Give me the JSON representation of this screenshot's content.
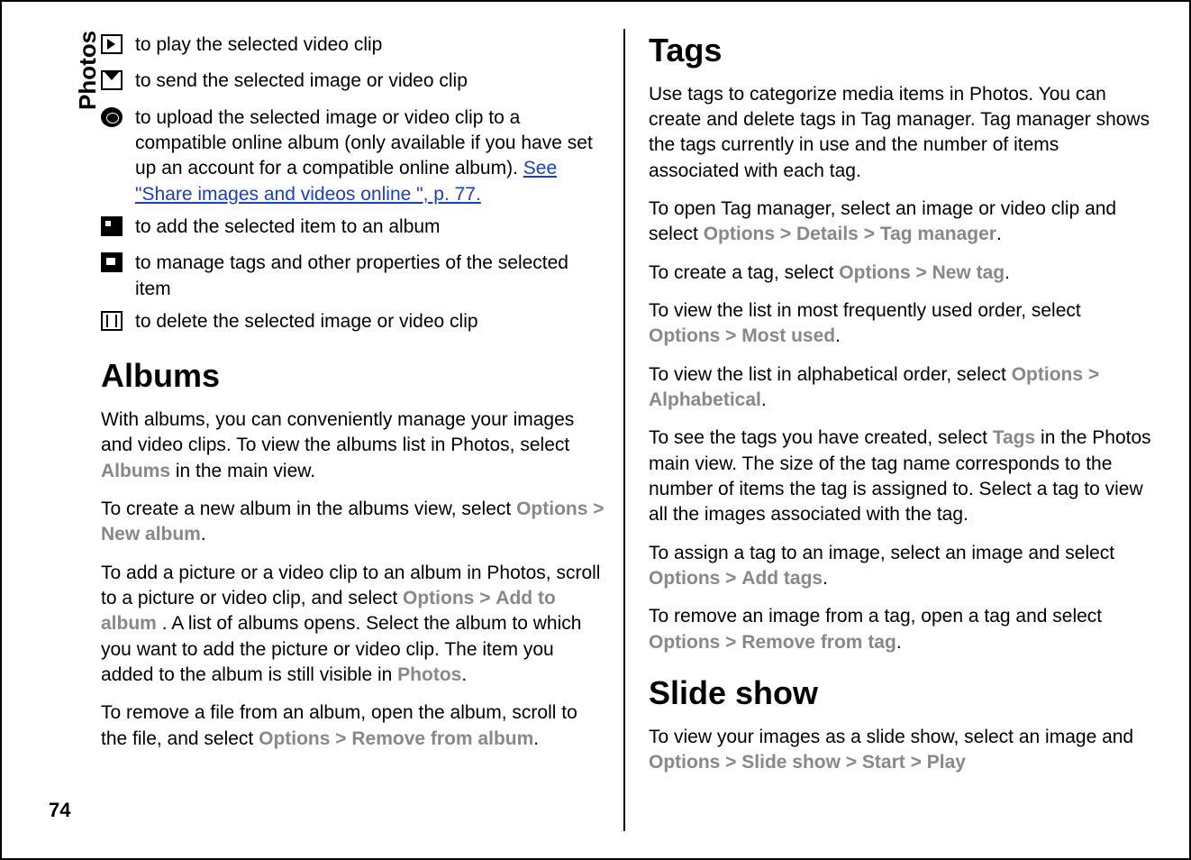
{
  "sidebar": {
    "label": "Photos",
    "page_number": "74"
  },
  "left": {
    "actions": {
      "play": "to play the selected video clip",
      "send": "to send the selected image or video clip",
      "upload_pre": " to upload the selected image or video clip to a compatible online album (only available if you have set up an account for a compatible online album). ",
      "upload_link": "See \"Share images and videos online \", p. 77.",
      "album": "to add the selected item to an album",
      "tags": "to manage tags and other properties of the selected item",
      "delete": "to delete the selected image or video clip"
    },
    "albums": {
      "heading": "Albums",
      "p1a": "With albums, you can conveniently manage your images and video clips. To view the albums list in Photos, select ",
      "p1_menu": "Albums",
      "p1b": " in the main view.",
      "p2a": "To create a new album in the albums view, select ",
      "p2_m1": "Options",
      "p2_m2": "New album",
      "p3a": "To add a picture or a video clip to an album in Photos, scroll to a picture or video clip, and select ",
      "p3_m1": "Options",
      "p3_m2": "Add to album",
      "p3b": ". A list of albums opens. Select the album to which you want to add the picture or video clip. The item you added to the album is still visible in ",
      "p3_m3": "Photos",
      "p4a": "To remove a file from an album, open the album, scroll to the file, and select ",
      "p4_m1": "Options",
      "p4_m2": "Remove from album"
    }
  },
  "right": {
    "tags": {
      "heading": "Tags",
      "p1": "Use tags to categorize media items in Photos. You can create and delete tags in Tag manager. Tag manager shows the tags currently in use and the number of items associated with each tag.",
      "p2a": "To open Tag manager, select an image or video clip and select ",
      "p2_m1": "Options",
      "p2_m2": "Details",
      "p2_m3": "Tag manager",
      "p3a": "To create a tag, select ",
      "p3_m1": "Options",
      "p3_m2": "New tag",
      "p4a": "To view the list in most frequently used order, select ",
      "p4_m1": "Options",
      "p4_m2": "Most used",
      "p5a": "To view the list in alphabetical order, select ",
      "p5_m1": "Options",
      "p5_m2": "Alphabetical",
      "p6a": "To see the tags you have created, select ",
      "p6_m1": "Tags",
      "p6b": " in the Photos main view. The size of the tag name corresponds to the number of items the tag is assigned to. Select a tag to view all the images associated with the tag.",
      "p7a": "To assign a tag to an image, select an image and select ",
      "p7_m1": "Options",
      "p7_m2": "Add tags",
      "p8a": "To remove an image from a tag, open a tag and select ",
      "p8_m1": "Options",
      "p8_m2": "Remove from tag"
    },
    "slideshow": {
      "heading": "Slide show",
      "p1a": "To view your images as a slide show, select an image and ",
      "m1": "Options",
      "m2": "Slide show",
      "m3": "Start",
      "m4": "Play"
    }
  },
  "sep": ">",
  "period": "."
}
